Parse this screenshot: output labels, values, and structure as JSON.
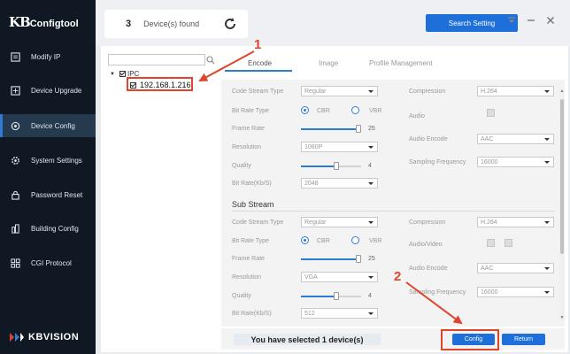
{
  "app": {
    "logo_kb": "KB",
    "logo_ct": "Configtool",
    "brand": "KBVISION"
  },
  "sidebar": {
    "items": [
      {
        "label": "Modify IP",
        "icon": "edit-icon"
      },
      {
        "label": "Device Upgrade",
        "icon": "upgrade-icon"
      },
      {
        "label": "Device Config",
        "icon": "config-icon",
        "active": true
      },
      {
        "label": "System Settings",
        "icon": "gear-icon"
      },
      {
        "label": "Password Reset",
        "icon": "lock-icon"
      },
      {
        "label": "Building Config",
        "icon": "building-icon"
      },
      {
        "label": "CGI Protocol",
        "icon": "protocol-icon"
      }
    ]
  },
  "topbar": {
    "device_count": "3",
    "device_label": "Device(s) found",
    "search_button": "Search Setting"
  },
  "tree": {
    "search_placeholder": "",
    "root_label": "IPC",
    "child_label": "192.168.1.216"
  },
  "tabs": [
    "Encode",
    "Image",
    "Profile Management"
  ],
  "main_stream": {
    "code_stream_type": {
      "label": "Code Stream Type",
      "value": "Regular"
    },
    "bit_rate_type": {
      "label": "Bit Rate Type",
      "options": [
        "CBR",
        "VBR"
      ],
      "selected": "CBR"
    },
    "frame_rate": {
      "label": "Frame Rate",
      "value": "25",
      "level": 1.0
    },
    "resolution": {
      "label": "Resolution",
      "value": "1080P"
    },
    "quality": {
      "label": "Quality",
      "value": "4",
      "level": 0.6
    },
    "bit_rate": {
      "label": "Bit Rate(Kb/S)",
      "value": "2048"
    },
    "compression": {
      "label": "Compression",
      "value": "H.264"
    },
    "audio": {
      "label": "Audio"
    },
    "audio_encode": {
      "label": "Audio Encode",
      "value": "AAC"
    },
    "sampling": {
      "label": "Sampling Frequency",
      "value": "16000"
    }
  },
  "sub_stream": {
    "title": "Sub Stream",
    "code_stream_type": {
      "label": "Code Stream Type",
      "value": "Regular"
    },
    "bit_rate_type": {
      "label": "Bit Rate Type",
      "options": [
        "CBR",
        "VBR"
      ],
      "selected": "CBR"
    },
    "frame_rate": {
      "label": "Frame Rate",
      "value": "25",
      "level": 1.0
    },
    "resolution": {
      "label": "Resolution",
      "value": "VGA"
    },
    "quality": {
      "label": "Quality",
      "value": "4",
      "level": 0.6
    },
    "bit_rate": {
      "label": "Bit Rate(Kb/S)",
      "value": "512"
    },
    "compression": {
      "label": "Compression",
      "value": "H.264"
    },
    "audio_video": {
      "label": "Audio/Video"
    },
    "audio_encode": {
      "label": "Audio Encode",
      "value": "AAC"
    },
    "sampling": {
      "label": "Sampling Frequency",
      "value": "16000"
    }
  },
  "footer": {
    "message": "You have selected 1 device(s)",
    "config_button": "Config",
    "return_button": "Return"
  },
  "annotations": {
    "step1": "1",
    "step2": "2",
    "color": "#e0442c"
  },
  "colors": {
    "accent": "#1e6fd9",
    "sidebar_bg": "#101923",
    "sidebar_active": "#25394f"
  }
}
